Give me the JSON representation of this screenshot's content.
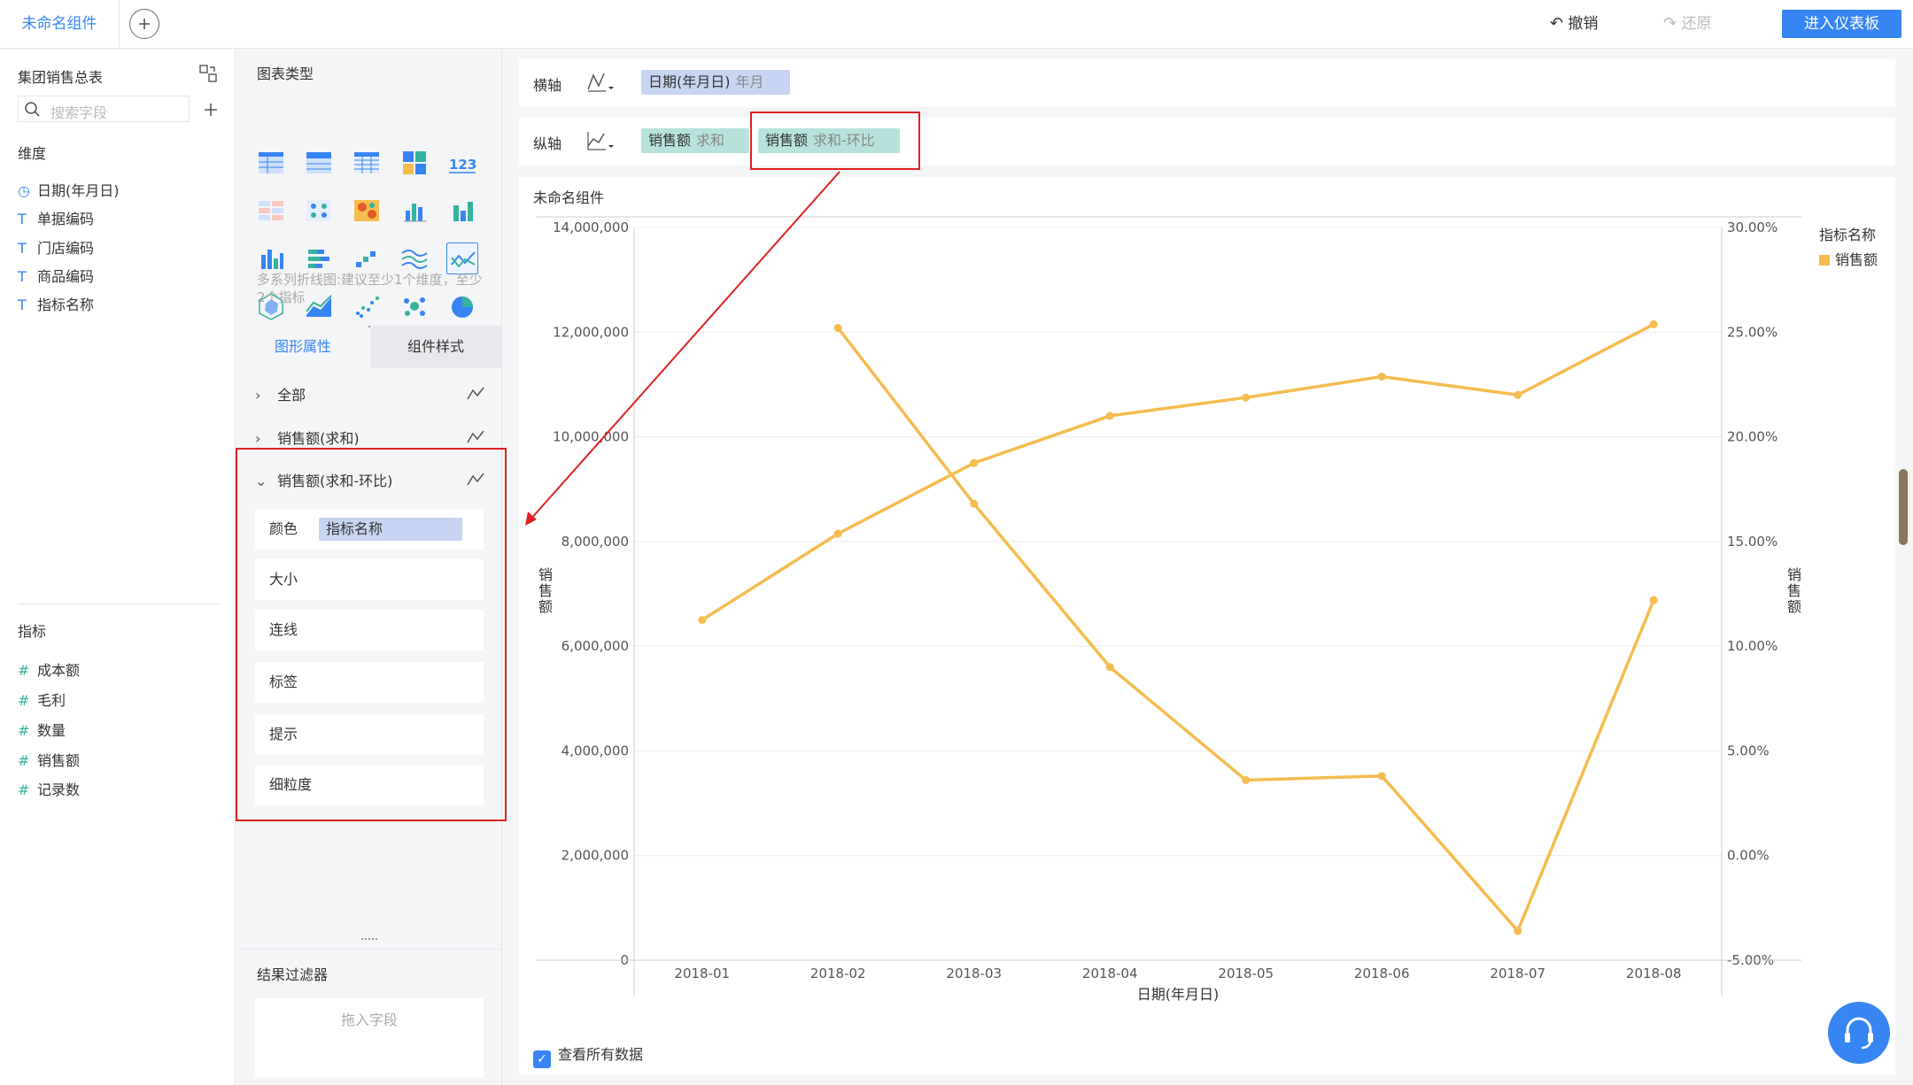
{
  "topbar": {
    "tab_label": "未命名组件",
    "undo_label": "撤销",
    "redo_label": "还原",
    "enter_dashboard_label": "进入仪表板"
  },
  "left_panel": {
    "dataset_title": "集团销售总表",
    "search_placeholder": "搜索字段",
    "dimensions_title": "维度",
    "dimensions": [
      {
        "icon": "clock-icon",
        "label": "日期(年月日)"
      },
      {
        "icon": "text-field-icon",
        "label": "单据编码"
      },
      {
        "icon": "text-field-icon",
        "label": "门店编码"
      },
      {
        "icon": "text-field-icon",
        "label": "商品编码"
      },
      {
        "icon": "text-field-icon",
        "label": "指标名称"
      }
    ],
    "measures_title": "指标",
    "measures": [
      {
        "icon": "number-icon",
        "label": "成本额"
      },
      {
        "icon": "number-icon",
        "label": "毛利"
      },
      {
        "icon": "number-icon",
        "label": "数量"
      },
      {
        "icon": "number-icon",
        "label": "销售额"
      },
      {
        "icon": "number-icon",
        "label": "记录数"
      }
    ]
  },
  "middle_panel": {
    "chart_type_title": "图表类型",
    "chart_type_hint": "多系列折线图:建议至少1个维度，至少2个指标",
    "tabs": [
      "图形属性",
      "组件样式"
    ],
    "prop_groups": [
      {
        "label": "全部",
        "expanded": false
      },
      {
        "label": "销售额(求和)",
        "expanded": false
      },
      {
        "label": "销售额(求和-环比)",
        "expanded": true
      }
    ],
    "attributes": [
      "颜色",
      "大小",
      "连线",
      "标签",
      "提示",
      "细粒度"
    ],
    "color_field": "指标名称",
    "filter_title": "结果过滤器",
    "filter_placeholder": "拖入字段"
  },
  "axes": {
    "x_label": "横轴",
    "x_field": "日期(年月日)",
    "x_field_sub": "年月",
    "y_label": "纵轴",
    "y_fields": [
      {
        "name": "销售额",
        "sub": "求和"
      },
      {
        "name": "销售额",
        "sub": "求和-环比"
      }
    ]
  },
  "chart_data": {
    "type": "line",
    "title": "未命名组件",
    "categories": [
      "2018-01",
      "2018-02",
      "2018-03",
      "2018-04",
      "2018-05",
      "2018-06",
      "2018-07",
      "2018-08"
    ],
    "series": [
      {
        "name": "销售额",
        "axis": "left",
        "values": [
          6500000,
          8150000,
          9500000,
          10400000,
          10750000,
          11150000,
          10800000,
          12150000
        ]
      },
      {
        "name": "销售额",
        "axis": "right",
        "values": [
          null,
          0.252,
          0.168,
          0.09,
          0.036,
          0.038,
          -0.036,
          0.122
        ]
      }
    ],
    "xlabel": "日期(年月日)",
    "ylabel": "销售额",
    "y2label": "销售额",
    "ylim": [
      0,
      14000000
    ],
    "y2lim": [
      -0.05,
      0.3
    ],
    "yticks": [
      "0",
      "2,000,000",
      "4,000,000",
      "6,000,000",
      "8,000,000",
      "10,000,000",
      "12,000,000",
      "14,000,000"
    ],
    "y2ticks": [
      "-5.00%",
      "0.00%",
      "5.00%",
      "10.00%",
      "15.00%",
      "20.00%",
      "25.00%",
      "30.00%"
    ],
    "legend_title": "指标名称",
    "legend_items": [
      "销售额"
    ],
    "line_color": "#f5bc4e",
    "grid": true
  },
  "footer": {
    "view_all_label": "查看所有数据"
  },
  "colors": {
    "accent": "#3685f2",
    "highlight": "#e02020"
  }
}
